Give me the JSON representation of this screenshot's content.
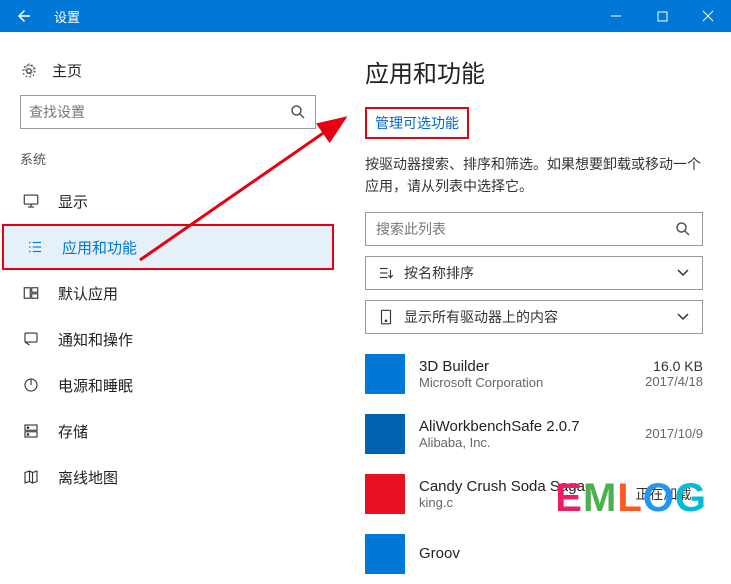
{
  "titlebar": {
    "title": "设置"
  },
  "home": {
    "label": "主页"
  },
  "search": {
    "placeholder": "查找设置"
  },
  "section": {
    "label": "系统"
  },
  "nav": [
    {
      "label": "显示",
      "icon": "monitor"
    },
    {
      "label": "应用和功能",
      "icon": "list",
      "active": true
    },
    {
      "label": "默认应用",
      "icon": "defaults"
    },
    {
      "label": "通知和操作",
      "icon": "notify"
    },
    {
      "label": "电源和睡眠",
      "icon": "power"
    },
    {
      "label": "存储",
      "icon": "storage"
    },
    {
      "label": "离线地图",
      "icon": "map"
    }
  ],
  "main": {
    "heading": "应用和功能",
    "manage_link": "管理可选功能",
    "description": "按驱动器搜索、排序和筛选。如果想要卸载或移动一个应用，请从列表中选择它。",
    "search_placeholder": "搜索此列表",
    "sort_label": "按名称排序",
    "filter_label": "显示所有驱动器上的内容"
  },
  "apps": [
    {
      "name": "3D Builder",
      "publisher": "Microsoft Corporation",
      "size": "16.0 KB",
      "date": "2017/4/18",
      "color": "blue1"
    },
    {
      "name": "AliWorkbenchSafe 2.0.7",
      "publisher": "Alibaba, Inc.",
      "size": "",
      "date": "2017/10/9",
      "color": "blue2"
    },
    {
      "name": "Candy Crush Soda Saga",
      "publisher": "king.c",
      "size": "正在加载...",
      "date": "",
      "color": "red"
    },
    {
      "name": "Groov",
      "publisher": "",
      "size": "",
      "date": "",
      "color": "blue1"
    }
  ],
  "watermark": "EMLOG"
}
